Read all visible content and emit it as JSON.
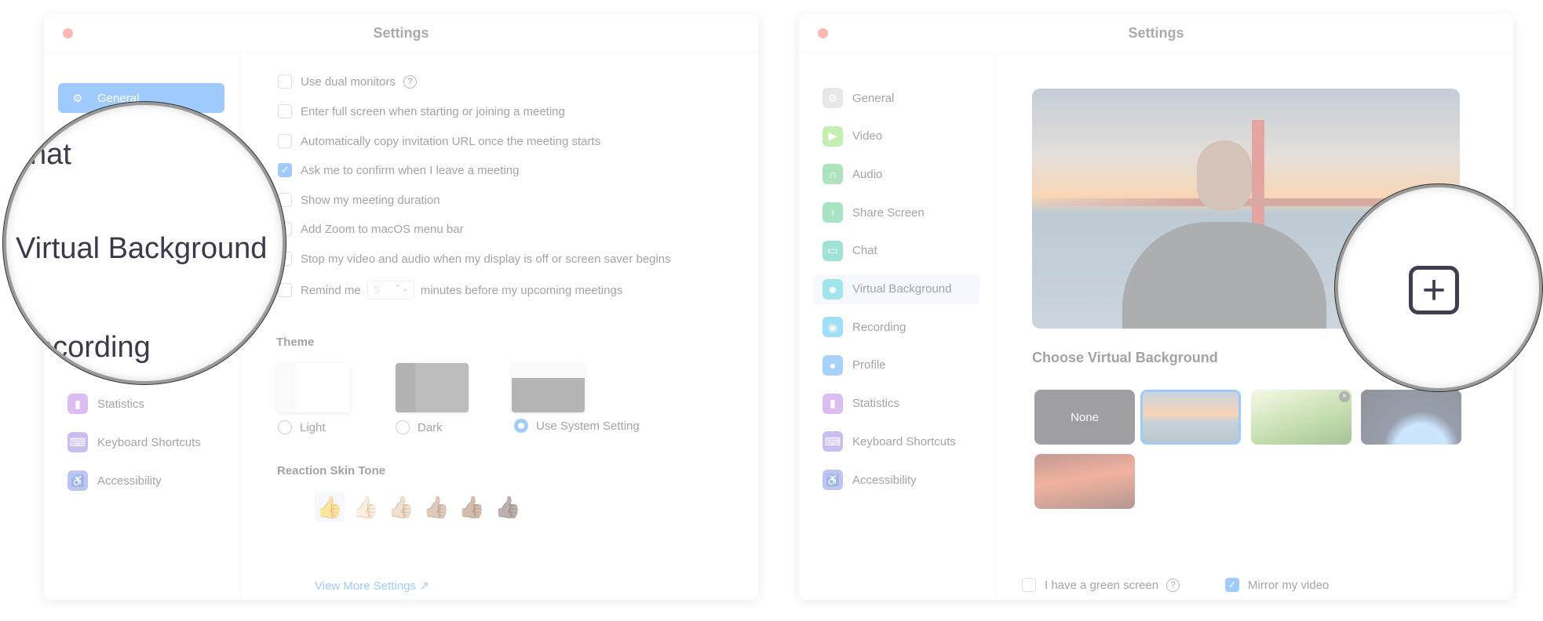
{
  "left_window": {
    "title": "Settings",
    "sidebar": {
      "items": [
        {
          "label": "General",
          "icon": "gear-icon"
        },
        {
          "label": "Keyboard Shortcuts",
          "icon": "keyboard-icon"
        },
        {
          "label": "Accessibility",
          "icon": "accessibility-icon"
        }
      ],
      "partial_label": "Statistics"
    },
    "options": [
      {
        "label": "Use dual monitors",
        "checked": false,
        "help": true
      },
      {
        "label": "Enter full screen when starting or joining a meeting",
        "checked": false
      },
      {
        "label": "Automatically copy invitation URL once the meeting starts",
        "checked": false
      },
      {
        "label": "Ask me to confirm when I leave a meeting",
        "checked": true
      },
      {
        "label": "Show my meeting duration",
        "checked": false
      },
      {
        "label": "Add Zoom to macOS menu bar",
        "checked": false
      },
      {
        "label": "Stop my video and audio when my display is off or screen saver begins",
        "checked": false
      }
    ],
    "remind": {
      "prefix": "Remind me",
      "value": "5",
      "suffix": "minutes before my upcoming meetings"
    },
    "theme": {
      "heading": "Theme",
      "options": [
        "Light",
        "Dark",
        "Use System Setting"
      ],
      "selected": "Use System Setting"
    },
    "skin_tone": {
      "heading": "Reaction Skin Tone",
      "tones": [
        "👍",
        "👍🏻",
        "👍🏼",
        "👍🏽",
        "👍🏾",
        "👍🏿"
      ],
      "selected_index": 0
    },
    "view_more": "View More Settings",
    "magnifier": {
      "above": "hat",
      "main": "Virtual Background",
      "below": "ecording"
    }
  },
  "right_window": {
    "title": "Settings",
    "sidebar": {
      "items": [
        {
          "label": "General",
          "icon": "gear-icon",
          "color": "#c9c9c9"
        },
        {
          "label": "Video",
          "icon": "video-icon",
          "color": "#7ed957"
        },
        {
          "label": "Audio",
          "icon": "headphones-icon",
          "color": "#4cc46e"
        },
        {
          "label": "Share Screen",
          "icon": "share-screen-icon",
          "color": "#3cc47a"
        },
        {
          "label": "Chat",
          "icon": "chat-icon",
          "color": "#30bfa6"
        },
        {
          "label": "Virtual Background",
          "icon": "person-card-icon",
          "color": "#2fc3d6"
        },
        {
          "label": "Recording",
          "icon": "record-icon",
          "color": "#2fb6ef"
        },
        {
          "label": "Profile",
          "icon": "profile-icon",
          "color": "#3d9cf5"
        },
        {
          "label": "Statistics",
          "icon": "chart-icon",
          "color": "#b36ee0"
        },
        {
          "label": "Keyboard Shortcuts",
          "icon": "keyboard-icon",
          "color": "#8a6fe0"
        },
        {
          "label": "Accessibility",
          "icon": "accessibility-icon",
          "color": "#6f7fe0"
        }
      ],
      "selected": "Virtual Background"
    },
    "choose_heading": "Choose Virtual Background",
    "backgrounds": [
      {
        "label": "None"
      },
      {
        "name": "golden-gate",
        "selected": true
      },
      {
        "name": "grass"
      },
      {
        "name": "earth"
      },
      {
        "name": "red-sky"
      }
    ],
    "green_screen": {
      "label": "I have a green screen",
      "checked": false
    },
    "mirror": {
      "label": "Mirror my video",
      "checked": true
    },
    "magnifier": {
      "icon": "add-plus-icon"
    }
  },
  "colors": {
    "accent": "#2d8cff",
    "close": "#ff5f57"
  }
}
